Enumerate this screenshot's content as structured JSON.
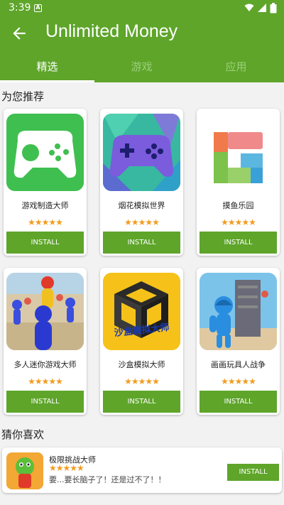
{
  "status_bar": {
    "time": "3:39",
    "notification_badge": "A"
  },
  "app_bar": {
    "title": "Unlimited Money",
    "back_icon": "arrow-left-icon"
  },
  "tabs": [
    {
      "label": "精选",
      "active": true
    },
    {
      "label": "游戏",
      "active": false
    },
    {
      "label": "应用",
      "active": false
    }
  ],
  "sections": {
    "recommended_title": "为您推荐",
    "guess_title": "猜你喜欢"
  },
  "apps": [
    {
      "name": "游戏制造大师",
      "stars": "★★★★★",
      "install": "INSTALL",
      "icon": "gamepad-icon"
    },
    {
      "name": "烟花模拟世界",
      "stars": "★★★★★",
      "install": "INSTALL",
      "icon": "fireworks-gamepad-icon"
    },
    {
      "name": "摸鱼乐园",
      "stars": "★★★★★",
      "install": "INSTALL",
      "icon": "blocks-icon"
    },
    {
      "name": "多人迷你游戏大师",
      "stars": "★★★★★",
      "install": "INSTALL",
      "icon": "stickman-crowd-icon"
    },
    {
      "name": "沙盒模拟大师",
      "stars": "★★★★★",
      "install": "INSTALL",
      "icon": "sandbox-cube-icon",
      "icon_text": "沙盒模拟大师"
    },
    {
      "name": "画画玩具人战争",
      "stars": "★★★★★",
      "install": "INSTALL",
      "icon": "blue-stickman-icon"
    }
  ],
  "guess": {
    "name": "极限挑战大师",
    "stars": "★★★★★",
    "description": "要...要长脑子了！还是过不了！！",
    "install": "INSTALL",
    "icon": "green-character-icon"
  },
  "colors": {
    "primary": "#5ea52a",
    "star": "#f29c1f"
  }
}
